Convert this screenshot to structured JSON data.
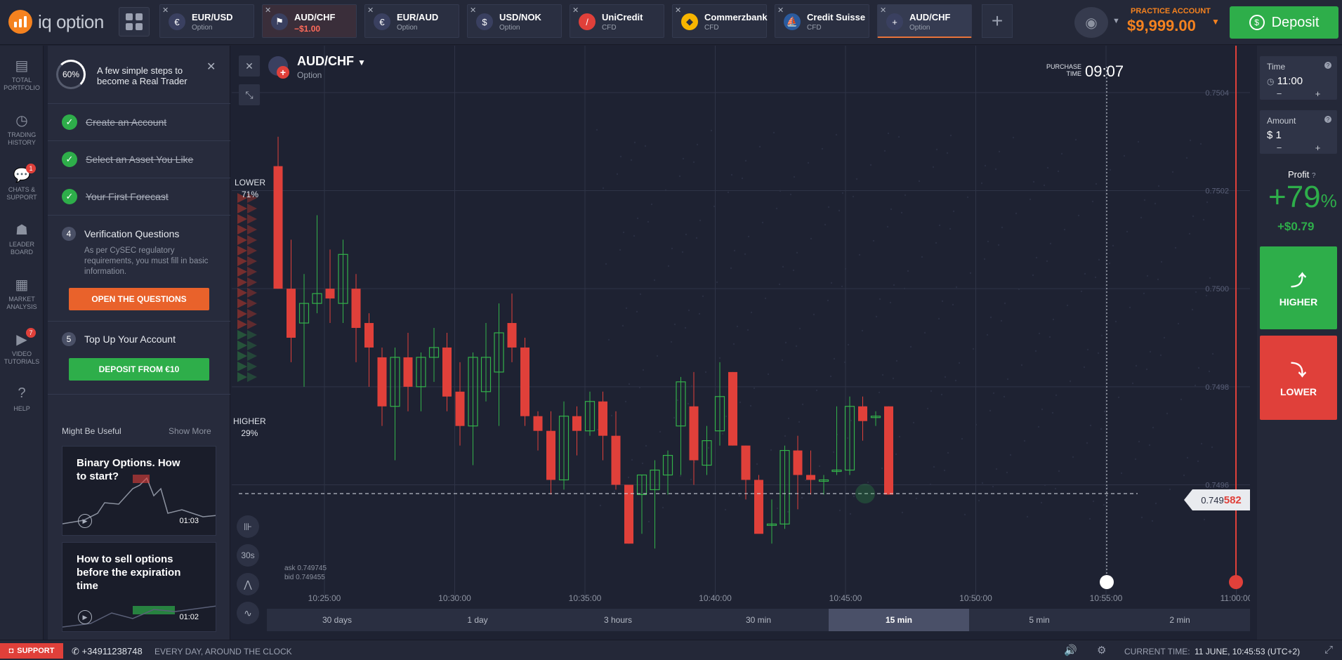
{
  "brand": {
    "name": "iq option"
  },
  "tabs": [
    {
      "name": "EUR/USD",
      "sub": "Option",
      "icon": "eu-us-flag-icon"
    },
    {
      "name": "AUD/CHF",
      "sub": "−$1.00",
      "icon": "au-ch-flag-icon"
    },
    {
      "name": "EUR/AUD",
      "sub": "Option",
      "icon": "eu-au-flag-icon"
    },
    {
      "name": "USD/NOK",
      "sub": "Option",
      "icon": "us-no-flag-icon"
    },
    {
      "name": "UniCredit",
      "sub": "CFD",
      "icon": "unicredit-logo-icon"
    },
    {
      "name": "Commerzbank",
      "sub": "CFD",
      "icon": "commerzbank-logo-icon"
    },
    {
      "name": "Credit Suisse",
      "sub": "CFD",
      "icon": "credit-suisse-logo-icon"
    },
    {
      "name": "AUD/CHF",
      "sub": "Option",
      "icon": "au-ch-flag-icon"
    }
  ],
  "account": {
    "label": "PRACTICE ACCOUNT",
    "balance": "$9,999.00"
  },
  "deposit_label": "Deposit",
  "nav": [
    {
      "label": "TOTAL PORTFOLIO",
      "icon": "portfolio-icon",
      "badge": ""
    },
    {
      "label": "TRADING HISTORY",
      "icon": "history-icon",
      "badge": ""
    },
    {
      "label": "CHATS & SUPPORT",
      "icon": "chat-icon",
      "badge": "1"
    },
    {
      "label": "LEADER BOARD",
      "icon": "leaderboard-icon",
      "badge": ""
    },
    {
      "label": "MARKET ANALYSIS",
      "icon": "market-analysis-icon",
      "badge": ""
    },
    {
      "label": "VIDEO TUTORIALS",
      "icon": "video-icon",
      "badge": "7"
    },
    {
      "label": "HELP",
      "icon": "help-icon",
      "badge": ""
    }
  ],
  "onboarding": {
    "progress": "60%",
    "headline": "A few simple steps to become a Real Trader",
    "done_steps": [
      "Create an Account",
      "Select an Asset You Like",
      "Your First Forecast"
    ],
    "step4": {
      "num": "4",
      "title": "Verification Questions",
      "desc": "As per CySEC regulatory requirements, you must fill in basic information.",
      "button": "OPEN THE QUESTIONS"
    },
    "step5": {
      "num": "5",
      "title": "Top Up Your Account",
      "button": "DEPOSIT FROM €10"
    }
  },
  "useful": {
    "title": "Might Be Useful",
    "show_more": "Show More",
    "cards": [
      {
        "title": "Binary Options. How to start?",
        "time": "01:03"
      },
      {
        "title": "How to sell options before the expiration time",
        "time": "01:02"
      }
    ]
  },
  "asset": {
    "name": "AUD/CHF",
    "type": "Option"
  },
  "purchase": {
    "label": "PURCHASE TIME",
    "time": "09:07"
  },
  "sentiment": {
    "lower_label": "LOWER",
    "lower_pct": "71%",
    "higher_label": "HIGHER",
    "higher_pct": "29%"
  },
  "quote": {
    "ask": "ask 0.749745",
    "bid": "bid 0.749455"
  },
  "price": {
    "prefix": "0.749",
    "suffix": "582"
  },
  "chart_tools": {
    "interval": "30s"
  },
  "chart_data": {
    "type": "candlestick",
    "y_ticks": [
      "0.7504",
      "0.7502",
      "0.7500",
      "0.7498",
      "0.7496"
    ],
    "x_ticks": [
      "10:25:00",
      "10:30:00",
      "10:35:00",
      "10:40:00",
      "10:45:00",
      "10:50:00",
      "10:55:00",
      "11:00:00"
    ],
    "ylim": [
      0.74935,
      0.75045
    ],
    "current_price": 0.749582,
    "candles": [
      [
        0.75025,
        0.75031,
        0.75,
        0.75
      ],
      [
        0.75,
        0.7501,
        0.74985,
        0.7499
      ],
      [
        0.74993,
        0.75003,
        0.7498,
        0.74997
      ],
      [
        0.74997,
        0.75015,
        0.74995,
        0.74999
      ],
      [
        0.75,
        0.75008,
        0.74993,
        0.74998
      ],
      [
        0.74997,
        0.7501,
        0.74993,
        0.75007
      ],
      [
        0.75,
        0.75003,
        0.74985,
        0.74992
      ],
      [
        0.74993,
        0.74995,
        0.7498,
        0.74988
      ],
      [
        0.74986,
        0.74988,
        0.74972,
        0.74976
      ],
      [
        0.74976,
        0.74988,
        0.74965,
        0.74986
      ],
      [
        0.74986,
        0.74991,
        0.74975,
        0.7498
      ],
      [
        0.7498,
        0.74987,
        0.74975,
        0.74986
      ],
      [
        0.74986,
        0.74992,
        0.74981,
        0.74988
      ],
      [
        0.74988,
        0.74991,
        0.74975,
        0.74978
      ],
      [
        0.74979,
        0.74985,
        0.74968,
        0.74972
      ],
      [
        0.74972,
        0.74987,
        0.74964,
        0.74986
      ],
      [
        0.74979,
        0.74993,
        0.74977,
        0.74986
      ],
      [
        0.74983,
        0.74997,
        0.74972,
        0.74991
      ],
      [
        0.74993,
        0.74999,
        0.74985,
        0.74988
      ],
      [
        0.74988,
        0.7499,
        0.74972,
        0.74974
      ],
      [
        0.74974,
        0.74975,
        0.74967,
        0.74971
      ],
      [
        0.74971,
        0.74975,
        0.74958,
        0.74961
      ],
      [
        0.74961,
        0.74977,
        0.74959,
        0.74974
      ],
      [
        0.74974,
        0.74976,
        0.74966,
        0.74971
      ],
      [
        0.74971,
        0.74979,
        0.7497,
        0.74977
      ],
      [
        0.74977,
        0.74979,
        0.74965,
        0.7497
      ],
      [
        0.7497,
        0.74975,
        0.74959,
        0.7496
      ],
      [
        0.7496,
        0.7496,
        0.74948,
        0.74948
      ],
      [
        0.74958,
        0.74962,
        0.7495,
        0.74962
      ],
      [
        0.74959,
        0.74965,
        0.74947,
        0.74963
      ],
      [
        0.74962,
        0.74967,
        0.74958,
        0.74966
      ],
      [
        0.74972,
        0.74982,
        0.74962,
        0.74981
      ],
      [
        0.74976,
        0.74983,
        0.7496,
        0.74965
      ],
      [
        0.74964,
        0.74972,
        0.74962,
        0.74969
      ],
      [
        0.74971,
        0.74985,
        0.74968,
        0.74978
      ],
      [
        0.74983,
        0.74983,
        0.74968,
        0.74968
      ],
      [
        0.74968,
        0.74968,
        0.74957,
        0.74961
      ],
      [
        0.74961,
        0.74962,
        0.74951,
        0.7495
      ],
      [
        0.74952,
        0.74957,
        0.74948,
        0.74952
      ],
      [
        0.74952,
        0.74968,
        0.74951,
        0.74967
      ],
      [
        0.74967,
        0.7497,
        0.74955,
        0.74962
      ],
      [
        0.74962,
        0.74967,
        0.74958,
        0.74961
      ],
      [
        0.74961,
        0.74962,
        0.74958,
        0.74961
      ],
      [
        0.74963,
        0.74976,
        0.74962,
        0.74963
      ],
      [
        0.74963,
        0.74978,
        0.74962,
        0.74976
      ],
      [
        0.74976,
        0.74978,
        0.74969,
        0.74973
      ],
      [
        0.74974,
        0.74975,
        0.74972,
        0.74974
      ],
      [
        0.74976,
        0.74976,
        0.74958,
        0.74958
      ]
    ]
  },
  "timeframes": [
    "30 days",
    "1 day",
    "3 hours",
    "30 min",
    "15 min",
    "5 min",
    "2 min"
  ],
  "active_timeframe": "15 min",
  "trade": {
    "time_label": "Time",
    "time_value": "11:00",
    "amount_label": "Amount",
    "amount_value": "$ 1",
    "minus": "−",
    "plus": "+",
    "profit_label": "Profit",
    "profit_pct": "+79",
    "profit_pct_sign": "%",
    "profit_amt": "+$0.79",
    "higher": "HIGHER",
    "lower": "LOWER"
  },
  "footer": {
    "support": "SUPPORT",
    "phone": "+34911238748",
    "hours": "EVERY DAY, AROUND THE CLOCK",
    "current_time_label": "CURRENT TIME:",
    "current_time": "11 JUNE, 10:45:53 (UTC+2)"
  },
  "colors": {
    "accent": "#f5821f",
    "green": "#2eae4a",
    "red": "#e0403a",
    "bg": "#1e2232"
  }
}
